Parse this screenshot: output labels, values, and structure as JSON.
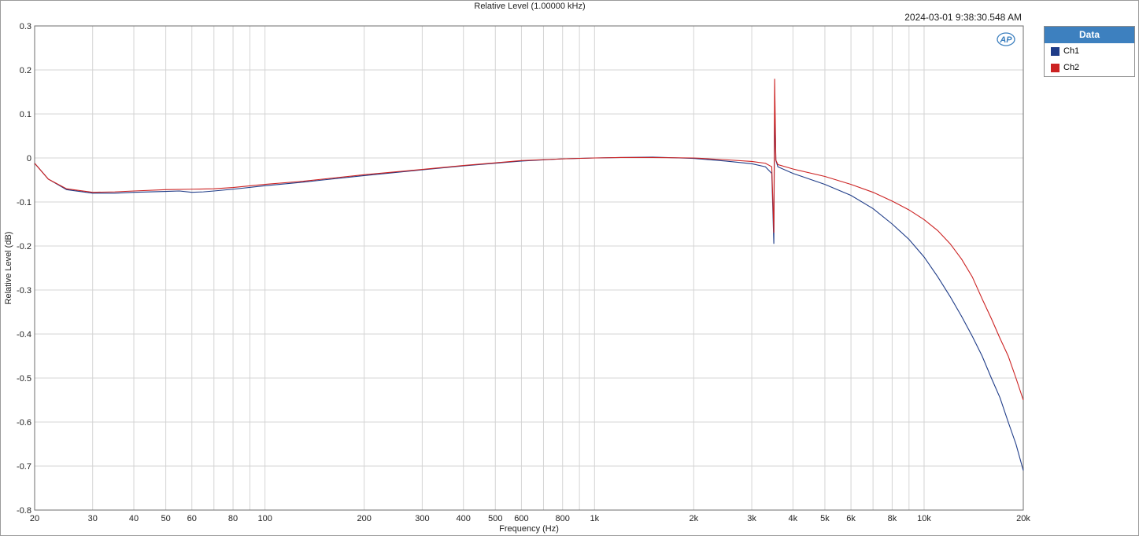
{
  "timestamp": "2024-03-01 9:38:30.548 AM",
  "logo_text": "AP",
  "legend": {
    "title": "Data",
    "items": [
      {
        "label": "Ch1",
        "color": "#1f3c88"
      },
      {
        "label": "Ch2",
        "color": "#cc2222"
      }
    ]
  },
  "chart_data": {
    "type": "line",
    "title": "Relative Level (1.00000 kHz)",
    "xlabel": "Frequency (Hz)",
    "ylabel": "Relative Level (dB)",
    "x_scale": "log",
    "xlim": [
      20,
      20000
    ],
    "ylim": [
      -0.8,
      0.3
    ],
    "grid": true,
    "legend_position": "top-right outside",
    "x_ticks": [
      {
        "value": 20,
        "label": "20"
      },
      {
        "value": 30,
        "label": "30"
      },
      {
        "value": 40,
        "label": "40"
      },
      {
        "value": 50,
        "label": "50"
      },
      {
        "value": 60,
        "label": "60"
      },
      {
        "value": 80,
        "label": "80"
      },
      {
        "value": 100,
        "label": "100"
      },
      {
        "value": 200,
        "label": "200"
      },
      {
        "value": 300,
        "label": "300"
      },
      {
        "value": 400,
        "label": "400"
      },
      {
        "value": 500,
        "label": "500"
      },
      {
        "value": 600,
        "label": "600"
      },
      {
        "value": 800,
        "label": "800"
      },
      {
        "value": 1000,
        "label": "1k"
      },
      {
        "value": 2000,
        "label": "2k"
      },
      {
        "value": 3000,
        "label": "3k"
      },
      {
        "value": 4000,
        "label": "4k"
      },
      {
        "value": 5000,
        "label": "5k"
      },
      {
        "value": 6000,
        "label": "6k"
      },
      {
        "value": 8000,
        "label": "8k"
      },
      {
        "value": 10000,
        "label": "10k"
      },
      {
        "value": 20000,
        "label": "20k"
      }
    ],
    "y_ticks": [
      {
        "value": 0.3,
        "label": "0.3"
      },
      {
        "value": 0.2,
        "label": "0.2"
      },
      {
        "value": 0.1,
        "label": "0.1"
      },
      {
        "value": 0,
        "label": "0"
      },
      {
        "value": -0.1,
        "label": "-0.1"
      },
      {
        "value": -0.2,
        "label": "-0.2"
      },
      {
        "value": -0.3,
        "label": "-0.3"
      },
      {
        "value": -0.4,
        "label": "-0.4"
      },
      {
        "value": -0.5,
        "label": "-0.5"
      },
      {
        "value": -0.6,
        "label": "-0.6"
      },
      {
        "value": -0.7,
        "label": "-0.7"
      },
      {
        "value": -0.8,
        "label": "-0.8"
      }
    ],
    "series": [
      {
        "name": "Ch1",
        "color": "#1f3c88",
        "points": [
          [
            20,
            -0.012
          ],
          [
            22,
            -0.048
          ],
          [
            25,
            -0.072
          ],
          [
            30,
            -0.08
          ],
          [
            35,
            -0.08
          ],
          [
            40,
            -0.078
          ],
          [
            50,
            -0.076
          ],
          [
            55,
            -0.075
          ],
          [
            60,
            -0.078
          ],
          [
            65,
            -0.077
          ],
          [
            70,
            -0.075
          ],
          [
            80,
            -0.071
          ],
          [
            100,
            -0.063
          ],
          [
            130,
            -0.055
          ],
          [
            150,
            -0.05
          ],
          [
            200,
            -0.04
          ],
          [
            300,
            -0.027
          ],
          [
            400,
            -0.018
          ],
          [
            500,
            -0.012
          ],
          [
            600,
            -0.007
          ],
          [
            800,
            -0.002
          ],
          [
            1000,
            0.0
          ],
          [
            1200,
            0.001
          ],
          [
            1500,
            0.002
          ],
          [
            2000,
            -0.001
          ],
          [
            2500,
            -0.007
          ],
          [
            3000,
            -0.013
          ],
          [
            3300,
            -0.02
          ],
          [
            3450,
            -0.035
          ],
          [
            3500,
            -0.195
          ],
          [
            3520,
            0.12
          ],
          [
            3550,
            -0.005
          ],
          [
            3600,
            -0.02
          ],
          [
            4000,
            -0.035
          ],
          [
            5000,
            -0.06
          ],
          [
            6000,
            -0.085
          ],
          [
            7000,
            -0.115
          ],
          [
            8000,
            -0.15
          ],
          [
            9000,
            -0.185
          ],
          [
            10000,
            -0.225
          ],
          [
            11000,
            -0.27
          ],
          [
            12000,
            -0.315
          ],
          [
            13000,
            -0.36
          ],
          [
            14000,
            -0.405
          ],
          [
            15000,
            -0.45
          ],
          [
            16000,
            -0.5
          ],
          [
            17000,
            -0.545
          ],
          [
            18000,
            -0.6
          ],
          [
            19000,
            -0.65
          ],
          [
            20000,
            -0.71
          ]
        ]
      },
      {
        "name": "Ch2",
        "color": "#cc2222",
        "points": [
          [
            20,
            -0.012
          ],
          [
            22,
            -0.048
          ],
          [
            25,
            -0.07
          ],
          [
            30,
            -0.078
          ],
          [
            35,
            -0.077
          ],
          [
            40,
            -0.075
          ],
          [
            50,
            -0.072
          ],
          [
            60,
            -0.071
          ],
          [
            70,
            -0.07
          ],
          [
            80,
            -0.067
          ],
          [
            100,
            -0.06
          ],
          [
            130,
            -0.053
          ],
          [
            150,
            -0.048
          ],
          [
            200,
            -0.038
          ],
          [
            300,
            -0.026
          ],
          [
            400,
            -0.017
          ],
          [
            500,
            -0.011
          ],
          [
            600,
            -0.006
          ],
          [
            800,
            -0.002
          ],
          [
            1000,
            0.0
          ],
          [
            1200,
            0.001
          ],
          [
            1500,
            0.001
          ],
          [
            2000,
            0.0
          ],
          [
            2500,
            -0.004
          ],
          [
            3000,
            -0.008
          ],
          [
            3300,
            -0.012
          ],
          [
            3450,
            -0.02
          ],
          [
            3500,
            -0.17
          ],
          [
            3520,
            0.18
          ],
          [
            3550,
            -0.005
          ],
          [
            3600,
            -0.015
          ],
          [
            4000,
            -0.025
          ],
          [
            5000,
            -0.042
          ],
          [
            6000,
            -0.06
          ],
          [
            7000,
            -0.078
          ],
          [
            8000,
            -0.098
          ],
          [
            9000,
            -0.118
          ],
          [
            10000,
            -0.14
          ],
          [
            11000,
            -0.165
          ],
          [
            12000,
            -0.195
          ],
          [
            13000,
            -0.23
          ],
          [
            14000,
            -0.27
          ],
          [
            15000,
            -0.32
          ],
          [
            16000,
            -0.365
          ],
          [
            17000,
            -0.41
          ],
          [
            18000,
            -0.45
          ],
          [
            19000,
            -0.5
          ],
          [
            20000,
            -0.55
          ]
        ]
      }
    ]
  }
}
